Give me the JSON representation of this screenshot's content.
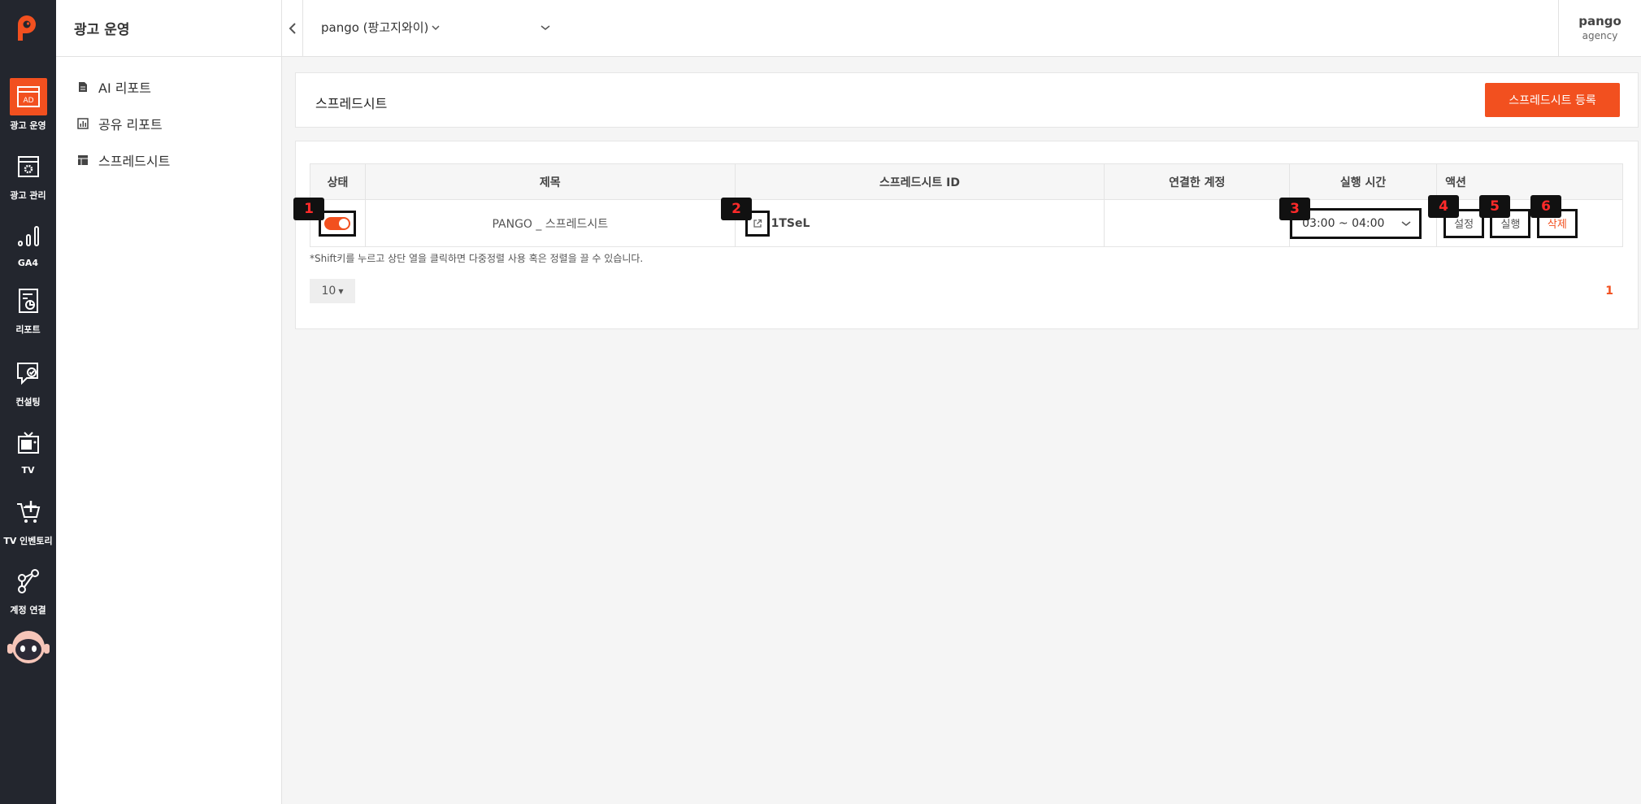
{
  "rail": {
    "items": [
      {
        "label": "광고 운영",
        "icon": "ad-icon"
      },
      {
        "label": "광고 관리",
        "icon": "settings-window-icon"
      },
      {
        "label": "GA4",
        "icon": "bar-chart-icon"
      },
      {
        "label": "리포트",
        "icon": "report-icon"
      },
      {
        "label": "컨설팅",
        "icon": "consulting-icon"
      },
      {
        "label": "TV",
        "icon": "tv-icon"
      },
      {
        "label": "TV 인벤토리",
        "icon": "cart-icon"
      },
      {
        "label": "계정 연결",
        "icon": "share-nodes-icon"
      }
    ],
    "bot_icon": "robot-avatar-icon",
    "ad_badge": "AD"
  },
  "subnav": {
    "title": "광고 운영",
    "items": [
      {
        "label": "AI 리포트",
        "icon": "document-icon"
      },
      {
        "label": "공유 리포트",
        "icon": "chart-box-icon"
      },
      {
        "label": "스프레드시트",
        "icon": "table-icon"
      }
    ]
  },
  "topbar": {
    "account": "pango (팡고지와이)",
    "user_name": "pango",
    "user_role": "agency"
  },
  "header": {
    "title": "스프레드시트",
    "register_button": "스프레드시트 등록"
  },
  "table": {
    "headers": [
      "상태",
      "제목",
      "스프레드시트 ID",
      "연결한 계정",
      "실행 시간",
      "액션"
    ],
    "rows": [
      {
        "status_on": true,
        "title": "PANGO _ 스프레드시트",
        "sheet_id": "1TSeL",
        "linked_account": "",
        "run_time": "03:00 ~ 04:00",
        "actions": {
          "settings": "설정",
          "run": "실행",
          "delete": "삭제"
        }
      }
    ]
  },
  "badges": [
    "1",
    "2",
    "3",
    "4",
    "5",
    "6"
  ],
  "note": "*Shift키를 누르고 상단 열을 클릭하면 다중정렬 사용 혹은 정렬을 끌 수 있습니다.",
  "pagination": {
    "page_size": "10",
    "current_page": "1"
  },
  "colors": {
    "accent": "#f2501f",
    "rail_bg": "#23262e"
  }
}
